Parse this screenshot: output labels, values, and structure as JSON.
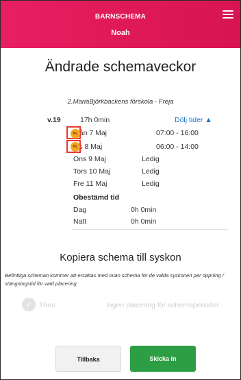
{
  "header": {
    "app_title": "BARNSCHEMA",
    "child_name": "Noah",
    "menu_icon": "hamburger-menu-icon",
    "gradient_colors": [
      "#e91e63",
      "#d81454"
    ]
  },
  "page_title": "Ändrade schemaveckor",
  "placement": "2.MariaBjörkbackens förskola - Freja",
  "week": {
    "number": "v.19",
    "total": "17h 0min",
    "toggle_label": "Dölj tider ▲",
    "days": [
      {
        "label": "Mån 7 Maj",
        "value": "07:00 - 16:00",
        "badge": "NL"
      },
      {
        "label": "Tis 8 Maj",
        "value": "06:00 - 14:00",
        "badge": "NL"
      },
      {
        "label": "Ons 9 Maj",
        "value": "Ledig"
      },
      {
        "label": "Tors 10 Maj",
        "value": "Ledig"
      },
      {
        "label": "Fre 11 Maj",
        "value": "Ledig"
      }
    ],
    "undetermined": {
      "title": "Obestämd tid",
      "rows": [
        {
          "label": "Dag",
          "value": "0h 0min"
        },
        {
          "label": "Natt",
          "value": "0h 0min"
        }
      ]
    }
  },
  "copy_section": {
    "title": "Kopiera schema till syskon",
    "description": "Befintliga scheman kommer att ersättas med ovan schema för de valda syskonen per öppning / stängningstid för vald placering",
    "sibling": {
      "check_icon": "check-circle-icon",
      "name": "Theo",
      "status": "Ingen placering för schemaperioder"
    }
  },
  "buttons": {
    "back": "Tillbaka",
    "submit": "Skicka in",
    "submit_color": "#2e9e45"
  }
}
